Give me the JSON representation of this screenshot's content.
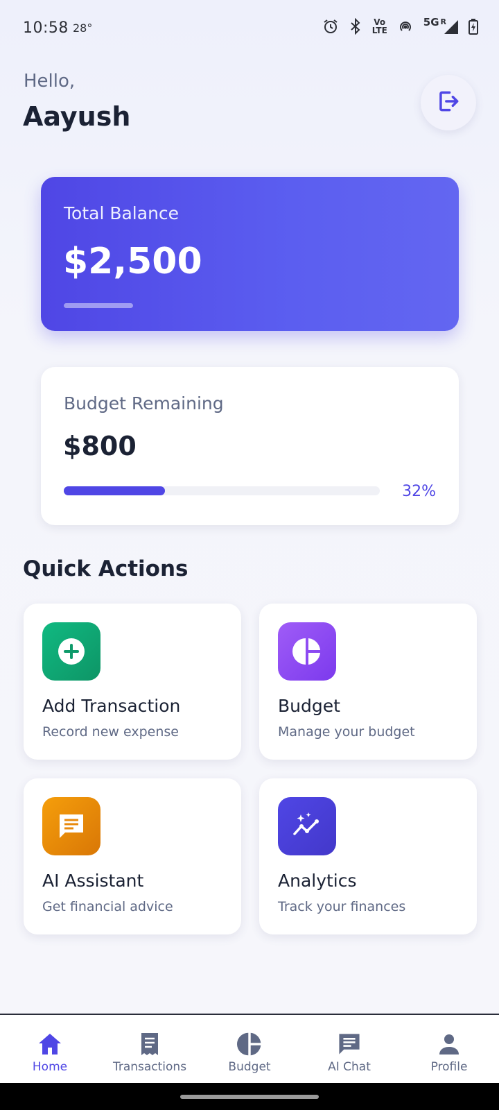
{
  "status_bar": {
    "time": "10:58",
    "temperature": "28°",
    "network": "5G",
    "roaming": "R",
    "volte": "Vo",
    "lte": "LTE",
    "icons": [
      "alarm-icon",
      "bluetooth-icon",
      "volte-icon",
      "hotspot-icon",
      "signal-icon",
      "battery-icon"
    ]
  },
  "header": {
    "greeting": "Hello,",
    "username": "Aayush",
    "logout_icon": "logout-icon"
  },
  "balance_card": {
    "label": "Total Balance",
    "amount": "$2,500",
    "gradient_start": "#4f46e5",
    "gradient_end": "#6366f1"
  },
  "budget_card": {
    "label": "Budget Remaining",
    "amount": "$800",
    "percent_text": "32%",
    "progress_fraction": 0.32,
    "bar_color": "#4f46e5"
  },
  "quick_actions": {
    "title": "Quick Actions",
    "items": [
      {
        "title": "Add Transaction",
        "subtitle": "Record new expense",
        "icon": "add-circle-icon",
        "color": "#10a36b"
      },
      {
        "title": "Budget",
        "subtitle": "Manage your budget",
        "icon": "pie-chart-icon",
        "color": "#8b47f0"
      },
      {
        "title": "AI Assistant",
        "subtitle": "Get financial advice",
        "icon": "chat-icon",
        "color": "#ea8a0c"
      },
      {
        "title": "Analytics",
        "subtitle": "Track your finances",
        "icon": "analytics-icon",
        "color": "#4f46e5"
      }
    ]
  },
  "bottom_nav": {
    "items": [
      {
        "label": "Home",
        "icon": "home-icon",
        "active": true
      },
      {
        "label": "Transactions",
        "icon": "receipt-icon",
        "active": false
      },
      {
        "label": "Budget",
        "icon": "pie-chart-icon",
        "active": false
      },
      {
        "label": "AI Chat",
        "icon": "chat-icon",
        "active": false
      },
      {
        "label": "Profile",
        "icon": "person-icon",
        "active": false
      }
    ],
    "active_color": "#4f46e5",
    "inactive_color": "#5f6985"
  }
}
